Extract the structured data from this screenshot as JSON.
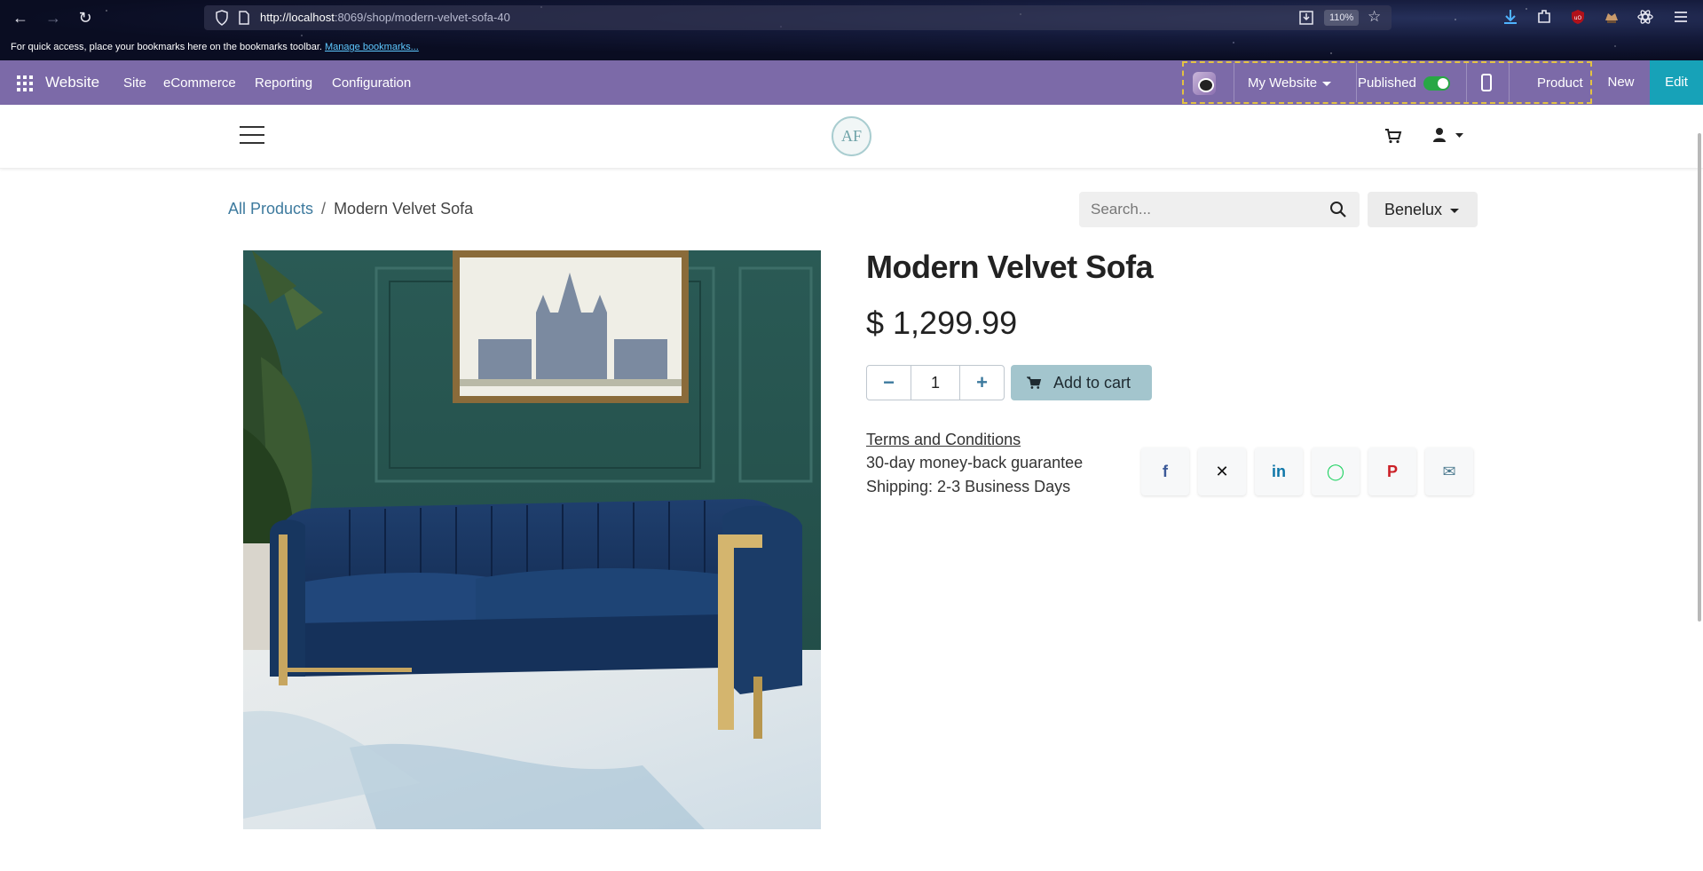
{
  "browser": {
    "url_host": "http://localhost",
    "url_rest": ":8069/shop/modern-velvet-sofa-40",
    "zoom": "110%",
    "bookmarks_text": "For quick access, place your bookmarks here on the bookmarks toolbar.",
    "bookmarks_link": "Manage bookmarks..."
  },
  "odoo": {
    "app_name": "Website",
    "menu": [
      "Site",
      "eCommerce",
      "Reporting",
      "Configuration"
    ],
    "website_selector": "My Website",
    "published_label": "Published",
    "published": true,
    "product_label": "Product",
    "new_label": "New",
    "edit_label": "Edit",
    "colors": {
      "bar": "#7c6aa8",
      "edit": "#17a2b8",
      "toggle_on": "#28a745"
    }
  },
  "site": {
    "logo_text": "AF"
  },
  "breadcrumb": {
    "parent": "All Products",
    "separator": "/",
    "current": "Modern Velvet Sofa"
  },
  "search": {
    "placeholder": "Search..."
  },
  "pricelist": {
    "label": "Benelux"
  },
  "product": {
    "name": "Modern Velvet Sofa",
    "price": "$ 1,299.99",
    "quantity": "1",
    "add_to_cart": "Add to cart",
    "terms": "Terms and Conditions",
    "guarantee": "30-day money-back guarantee",
    "shipping": "Shipping: 2-3 Business Days"
  },
  "share": [
    {
      "name": "facebook-share-button",
      "icon": "facebook-icon",
      "glyph": "f",
      "color": "#3b5998"
    },
    {
      "name": "x-share-button",
      "icon": "x-icon",
      "glyph": "𝕏",
      "color": "#111111"
    },
    {
      "name": "linkedin-share-button",
      "icon": "linkedin-icon",
      "glyph": "in",
      "color": "#0e76a8"
    },
    {
      "name": "whatsapp-share-button",
      "icon": "whatsapp-icon",
      "glyph": "◯",
      "color": "#25d366"
    },
    {
      "name": "pinterest-share-button",
      "icon": "pinterest-icon",
      "glyph": "P",
      "color": "#cb2027"
    },
    {
      "name": "email-share-button",
      "icon": "email-icon",
      "glyph": "✉",
      "color": "#4f7c91"
    }
  ]
}
